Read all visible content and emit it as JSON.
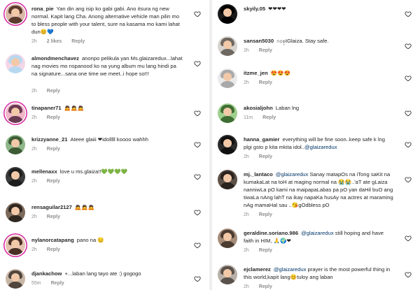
{
  "left_column": [
    {
      "username": "rona_pie",
      "text": "Yan din ang isip ko gabi gabi. Ano itsura ng new normal. Kapit lang Cha. Anong alternative vehicle man pilin mo to bless people with your talent, sure na kasama mo kami lahat dun😊💙",
      "time": "2h",
      "likes": "2 likes",
      "reply": "Reply",
      "avatar_colors": [
        "#d9b8a8",
        "#5a3b2e"
      ]
    },
    {
      "username": "almondmenchavez",
      "text": "anonpo pelikula yan Ms.glaizaredux...lahat nag movies mo nspanood ko na yung album mu lang hindi pa na signature...sana one time we meet..i hope so!!!",
      "time": "2h",
      "likes": "",
      "reply": "Reply",
      "avatar_colors": [
        "#f3d6e8",
        "#b7d9f0"
      ]
    },
    {
      "username": "tinapaner71",
      "text": "🙇🙇🙇",
      "time": "2h",
      "likes": "",
      "reply": "Reply",
      "avatar_colors": [
        "#f0b6c8",
        "#6a3a52"
      ]
    },
    {
      "username": "krizzyanne_21",
      "text": "Ateee glaiii ❤idolllll koooo wahhh",
      "time": "2h",
      "likes": "",
      "reply": "Reply",
      "avatar_colors": [
        "#8fb88a",
        "#3d5c36"
      ]
    },
    {
      "username": "mellenaxx",
      "text": "love u ms.glaiza!!💚💚💚💚",
      "time": "2h",
      "likes": "",
      "reply": "Reply",
      "avatar_colors": [
        "#3b3b3b",
        "#1e1e1e"
      ]
    },
    {
      "username": "rensaguilar2127",
      "text": "🙇🙇🙇",
      "time": "2h",
      "likes": "",
      "reply": "Reply",
      "avatar_colors": [
        "#7c6a5a",
        "#2e2620"
      ]
    },
    {
      "username": "nylanorcatapang",
      "text": "pano na 😔",
      "time": "2h",
      "likes": "",
      "reply": "Reply",
      "avatar_colors": [
        "#e4c3b0",
        "#4a2f24"
      ]
    },
    {
      "username": "djankachow",
      "text": "+...laban lang tayo ate :) gogogo",
      "time": "55m",
      "likes": "",
      "reply": "Reply",
      "avatar_colors": [
        "#c9b7a6",
        "#50463d"
      ]
    }
  ],
  "right_column": [
    {
      "username": "skyily.05",
      "text": "❤❤❤❤",
      "time": "",
      "likes": "",
      "reply": "",
      "avatar_colors": [
        "#1a1a1a",
        "#000000"
      ]
    },
    {
      "username": "sansan5030",
      "text": "ဂ၀စုIGlaiza. Stay safe.",
      "time": "2h",
      "likes": "",
      "reply": "Reply",
      "avatar_colors": [
        "#d7d3ce",
        "#6f6860"
      ]
    },
    {
      "username": "itzme_jen",
      "text": "😍😍😍",
      "time": "2h",
      "likes": "",
      "reply": "Reply",
      "avatar_colors": [
        "#eaeaea",
        "#a9a9a9"
      ]
    },
    {
      "username": "akosialjohn",
      "text": "Laban lng",
      "time": "11m",
      "likes": "",
      "reply": "Reply",
      "avatar_colors": [
        "#9fcf8e",
        "#3f6e34"
      ]
    },
    {
      "username": "hanna_gamier",
      "text": "everything will be fine soon..keep safe k lng plgi gsto p kita mkita idol..",
      "mention": "@glaizaredux",
      "time": "2h",
      "likes": "",
      "reply": "Reply",
      "avatar_colors": [
        "#2b2b2b",
        "#111111"
      ]
    },
    {
      "username": "mj._lantaco",
      "mention": "@glaizaredux",
      "text": "Sanay matapOs na iTong saKit na kumakaLat na toH at maging normal na 😭😭..'aT ate gLaiza nanniwLa pO kami na maipapaLabas pa pO yan daHil buO ang tiwaLa nAng lahT na ikay napaKa husAy na actres at maraming nAg mamaHal sau ..😘gOdbless pO",
      "time": "2h",
      "likes": "",
      "reply": "Reply",
      "avatar_colors": [
        "#5e5148",
        "#2a231e"
      ]
    },
    {
      "username": "geraldine.soriano.986",
      "mention": "@glaizaredux",
      "text": "still hoping and have faith in HIM, 🙏🌍❤",
      "time": "2h",
      "likes": "",
      "reply": "Reply",
      "avatar_colors": [
        "#a58d7a",
        "#4b3c31"
      ]
    },
    {
      "username": "ejclamerez",
      "mention": "@glaizaredux",
      "text": "prayer is the most powerful thing in this world,kapit lang😊tuloy ang laban",
      "time": "2h",
      "likes": "",
      "reply": "Reply",
      "avatar_colors": [
        "#b9b1a9",
        "#5a524b"
      ]
    }
  ]
}
